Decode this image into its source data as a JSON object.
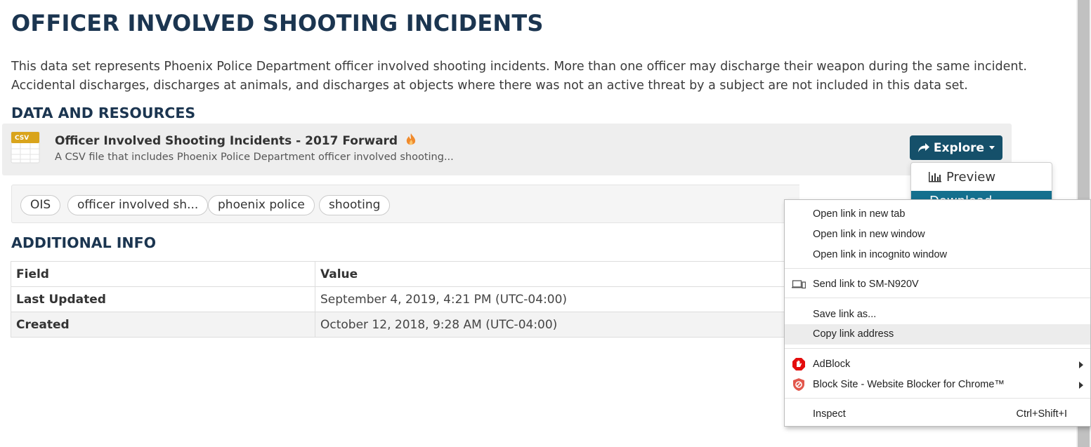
{
  "page": {
    "title": "OFFICER INVOLVED SHOOTING INCIDENTS",
    "description_lines": [
      "This data set represents Phoenix Police Department officer involved shooting incidents. More than one officer may discharge their weapon during the same incident.",
      "Accidental discharges, discharges at animals, and discharges at objects where there was not an active threat by a subject are not included in this data set."
    ]
  },
  "resources": {
    "heading": "DATA AND RESOURCES",
    "item": {
      "format_badge": "CSV",
      "title": "Officer Involved Shooting Incidents - 2017 Forward",
      "description": "A CSV file that includes Phoenix Police Department officer involved shooting...",
      "explore_label": "Explore",
      "menu": {
        "preview_label": "Preview",
        "download_label": "Download"
      }
    }
  },
  "tags": [
    "OIS",
    "officer involved sh...",
    "phoenix police",
    "shooting"
  ],
  "additional_info": {
    "heading": "ADDITIONAL INFO",
    "columns": [
      "Field",
      "Value"
    ],
    "rows": [
      {
        "field": "Last Updated",
        "value": "September 4, 2019, 4:21 PM (UTC-04:00)"
      },
      {
        "field": "Created",
        "value": "October 12, 2018, 9:28 AM (UTC-04:00)"
      }
    ]
  },
  "context_menu": {
    "open_new_tab": "Open link in new tab",
    "open_new_window": "Open link in new window",
    "open_incognito": "Open link in incognito window",
    "send_to_device": "Send link to SM-N920V",
    "save_link_as": "Save link as...",
    "copy_link_address": "Copy link address",
    "adblock": "AdBlock",
    "block_site": "Block Site - Website Blocker for Chrome™",
    "inspect": "Inspect",
    "inspect_shortcut": "Ctrl+Shift+I"
  },
  "colors": {
    "heading": "#1b3550",
    "explore_button": "#15506a",
    "download_highlight": "#15708e",
    "adblock_red": "#e40d0d",
    "blocksite_red": "#e2574c"
  }
}
